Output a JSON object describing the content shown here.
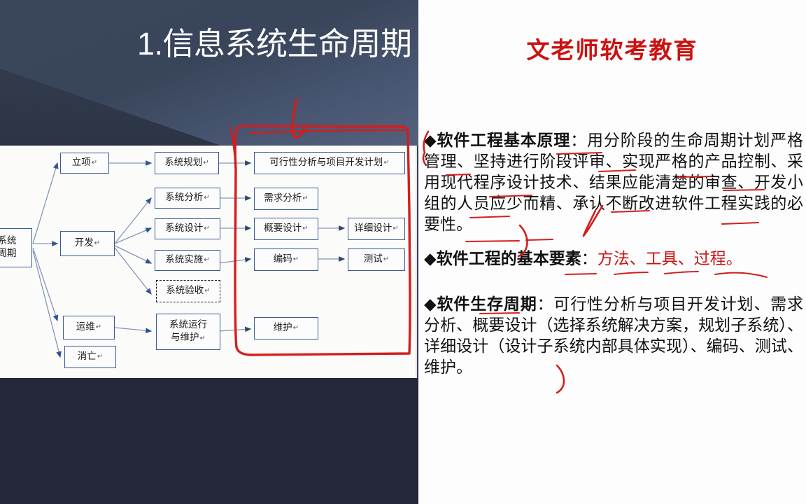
{
  "slide": {
    "title": "1.信息系统生命周期",
    "background_color": "#343e51"
  },
  "diagram": {
    "root": "系统\n生命周期",
    "root_line1": "系统",
    "root_line2": "周期",
    "nodes": [
      {
        "id": "liXiang",
        "label": "立项",
        "col": 1
      },
      {
        "id": "kaiFa",
        "label": "开发",
        "col": 1
      },
      {
        "id": "yunWei",
        "label": "运维",
        "col": 1
      },
      {
        "id": "xiaoWang",
        "label": "消亡",
        "col": 1
      },
      {
        "id": "xiTongGuiHua",
        "label": "系统规划",
        "col": 2
      },
      {
        "id": "xiTongFenXi",
        "label": "系统分析",
        "col": 2
      },
      {
        "id": "xiTongSheJi",
        "label": "系统设计",
        "col": 2
      },
      {
        "id": "xiTongShiShi",
        "label": "系统实施",
        "col": 2
      },
      {
        "id": "xiTongYanShou",
        "label": "系统验收",
        "col": 2,
        "style": "dashed"
      },
      {
        "id": "xiTongYunXing",
        "label": "系统运行\n与维护",
        "col": 2
      },
      {
        "id": "keXingXing",
        "label": "可行性分析与项目开发计划",
        "col": 3
      },
      {
        "id": "xuQiuFenXi",
        "label": "需求分析",
        "col": 3
      },
      {
        "id": "gaiYaoSheJi",
        "label": "概要设计",
        "col": 3
      },
      {
        "id": "bianMa",
        "label": "编码",
        "col": 3
      },
      {
        "id": "weiHu",
        "label": "维护",
        "col": 3
      },
      {
        "id": "xiangXiSheJi",
        "label": "详细设计",
        "col": 4
      },
      {
        "id": "ceShi",
        "label": "测试",
        "col": 4
      }
    ],
    "node_labels": {
      "liXiang": "立项",
      "kaiFa": "开发",
      "yunWei": "运维",
      "xiaoWang": "消亡",
      "xiTongGuiHua": "系统规划",
      "xiTongFenXi": "系统分析",
      "xiTongSheJi": "系统设计",
      "xiTongShiShi": "系统实施",
      "xiTongYanShou": "系统验收",
      "xiTongYunXingL1": "系统运行",
      "xiTongYunXingL2": "与维护",
      "keXingXing": "可行性分析与项目开发计划",
      "xuQiuFenXi": "需求分析",
      "gaiYaoSheJi": "概要设计",
      "bianMa": "编码",
      "weiHu": "维护",
      "xiangXiSheJi": "详细设计",
      "ceShi": "测试"
    },
    "box_border_color": "#3a5a94",
    "dashed_border_color": "#17171b"
  },
  "notes": {
    "header": "文老师软考教育",
    "header_color": "#cc1111",
    "paragraphs": [
      {
        "bullet": "◆",
        "heading": "软件工程基本原理",
        "colon": "：",
        "body": "用分阶段的生命周期计划严格管理、坚持进行阶段评审、实现严格的产品控制、采用现代程序设计技术、结果应能清楚的审查、开发小组的人员应少而精、承认不断改进软件工程实践的必要性。"
      },
      {
        "bullet": "◆",
        "heading": "软件工程的基本要素",
        "colon": "：",
        "body_red": "方法、工具、过程。"
      },
      {
        "bullet": "◆",
        "heading": "软件生存周期",
        "colon": "：",
        "body": "可行性分析与项目开发计划、需求分析、概要设计（选择系统解决方案，规划子系统）、详细设计（设计子系统内部具体实现）、编码、测试、维护。"
      }
    ]
  },
  "annotation": {
    "ink_color": "#d31e1e",
    "description": "hand-drawn red marker: bracket box around middle diagram column, arrow above it, underlines under key terms in notes"
  }
}
